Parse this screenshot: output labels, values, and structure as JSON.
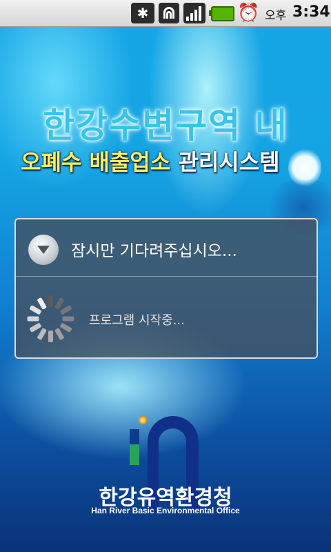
{
  "status_bar": {
    "icons": [
      "bluetooth-icon",
      "wifi-icon",
      "signal-icon",
      "battery-icon",
      "alarm-icon"
    ],
    "ampm": "오후",
    "time": "3:34"
  },
  "splash": {
    "title_line1": "한강수변구역 내",
    "title_line2_part1": "오폐수 배출업소",
    "title_line2_part2": "관리시스템"
  },
  "dialog": {
    "title": "잠시만 기다려주십시오...",
    "message": "프로그램 시작중...",
    "icon": "chevron-down-icon"
  },
  "organization": {
    "name": "한강유역환경청",
    "name_en": "Han River Basic Environmental Office"
  },
  "colors": {
    "title_cyan": "#38c4e9",
    "title_yellow": "#ffef63",
    "logo_navy": "#102f88",
    "logo_green": "#2aa35a"
  }
}
